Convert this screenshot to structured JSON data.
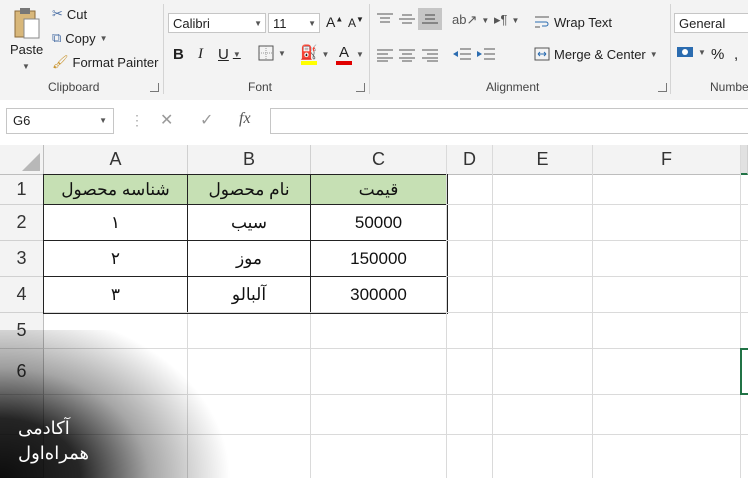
{
  "ribbon": {
    "clipboard": {
      "paste_label": "Paste",
      "cut_label": "Cut",
      "copy_label": "Copy",
      "format_painter_label": "Format Painter",
      "group_label": "Clipboard"
    },
    "font": {
      "font_name": "Calibri",
      "font_size": "11",
      "bold": "B",
      "italic": "I",
      "underline": "U",
      "group_label": "Font",
      "font_color": "#e00000",
      "fill_color": "#ffff00"
    },
    "alignment": {
      "wrap_text_label": "Wrap Text",
      "merge_center_label": "Merge & Center",
      "group_label": "Alignment"
    },
    "number": {
      "format": "General",
      "percent": "%",
      "group_label": "Numbe"
    }
  },
  "formula_bar": {
    "name_box": "G6",
    "cancel": "✕",
    "enter": "✓",
    "fx": "fx",
    "value": ""
  },
  "sheet": {
    "columns": [
      "A",
      "B",
      "C",
      "D",
      "E",
      "F"
    ],
    "rows": [
      "1",
      "2",
      "3",
      "4",
      "5",
      "6"
    ],
    "header_fill": "#c6e0b4",
    "table": {
      "headers": [
        "شناسه محصول",
        "نام محصول",
        "قیمت"
      ],
      "rows": [
        [
          "١",
          "سیب",
          "50000"
        ],
        [
          "٢",
          "موز",
          "150000"
        ],
        [
          "٣",
          "آلبالو",
          "300000"
        ]
      ]
    },
    "selected_cell": "G6"
  },
  "watermark": {
    "line1": "آکادمی",
    "line2": "همراه‌اول"
  }
}
